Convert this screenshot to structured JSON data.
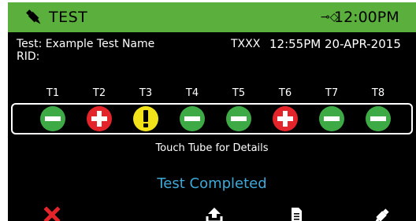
{
  "header": {
    "title": "TEST",
    "time": "12:00PM",
    "header_color": "#5aaf3d",
    "icons": [
      "dropper-icon",
      "usb-icon"
    ]
  },
  "test_info": {
    "test_name": "Test: Example Test Name",
    "rid": "RID:",
    "code": "TXXX",
    "datetime": "12:55PM 20-APR-2015"
  },
  "tubes": [
    {
      "label": "T1",
      "result": "negative",
      "color": "#3daa46"
    },
    {
      "label": "T2",
      "result": "positive",
      "color": "#e3242b"
    },
    {
      "label": "T3",
      "result": "warning",
      "color": "#f2e21a"
    },
    {
      "label": "T4",
      "result": "negative",
      "color": "#3daa46"
    },
    {
      "label": "T5",
      "result": "negative",
      "color": "#3daa46"
    },
    {
      "label": "T6",
      "result": "positive",
      "color": "#e3242b"
    },
    {
      "label": "T7",
      "result": "negative",
      "color": "#3daa46"
    },
    {
      "label": "T8",
      "result": "negative",
      "color": "#3daa46"
    }
  ],
  "touch_hint": "Touch Tube for Details",
  "status": {
    "text": "Test Completed",
    "color": "#3ea9d8"
  },
  "toolbar": {
    "buttons": [
      "cancel-icon",
      "upload-icon",
      "document-icon",
      "dropper-icon"
    ],
    "cancel_color": "#e3242b"
  }
}
